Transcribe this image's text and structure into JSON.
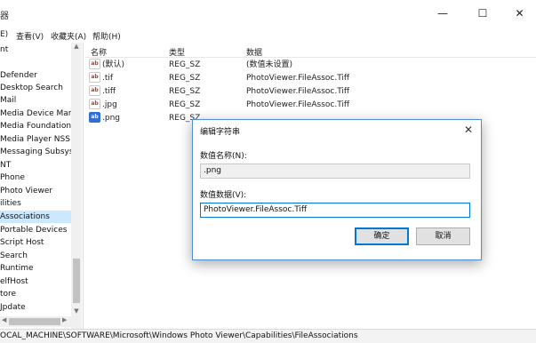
{
  "titlebar": {
    "title": "器",
    "minimize": "—",
    "maximize": "☐",
    "close": "✕"
  },
  "menu": [
    {
      "label": "E)"
    },
    {
      "label": "查看(V)"
    },
    {
      "label": "收藏夹(A)"
    },
    {
      "label": "帮助(H)"
    }
  ],
  "tree": {
    "items": [
      "nt",
      "",
      "Defender",
      "Desktop Search",
      "Mail",
      "Media Device Mana",
      "Media Foundation",
      "Media Player NSS",
      "Messaging Subsyst",
      "NT",
      "Phone",
      "Photo Viewer",
      "ilities",
      "Associations",
      "Portable Devices",
      "Script Host",
      "Search",
      "Runtime",
      "elfHost",
      "tore",
      "Jpdate"
    ],
    "selected_index": 13
  },
  "list": {
    "headers": {
      "name": "名称",
      "type": "类型",
      "data": "数据"
    },
    "rows": [
      {
        "icon": "ab",
        "name": "(默认)",
        "type": "REG_SZ",
        "data": "(数值未设置)"
      },
      {
        "icon": "ab",
        "name": ".tif",
        "type": "REG_SZ",
        "data": "PhotoViewer.FileAssoc.Tiff"
      },
      {
        "icon": "ab",
        "name": ".tiff",
        "type": "REG_SZ",
        "data": "PhotoViewer.FileAssoc.Tiff"
      },
      {
        "icon": "ab",
        "name": ".jpg",
        "type": "REG_SZ",
        "data": "PhotoViewer.FileAssoc.Tiff"
      },
      {
        "icon": "ab",
        "name": ".png",
        "type": "REG_SZ",
        "data": ""
      }
    ]
  },
  "dialog": {
    "title": "编辑字符串",
    "close": "✕",
    "name_label": "数值名称(N):",
    "name_value": ".png",
    "data_label": "数值数据(V):",
    "data_value": "PhotoViewer.FileAssoc.Tiff",
    "ok_label": "确定",
    "cancel_label": "取消"
  },
  "statusbar": {
    "path": "OCAL_MACHINE\\SOFTWARE\\Microsoft\\Windows Photo Viewer\\Capabilities\\FileAssociations"
  }
}
